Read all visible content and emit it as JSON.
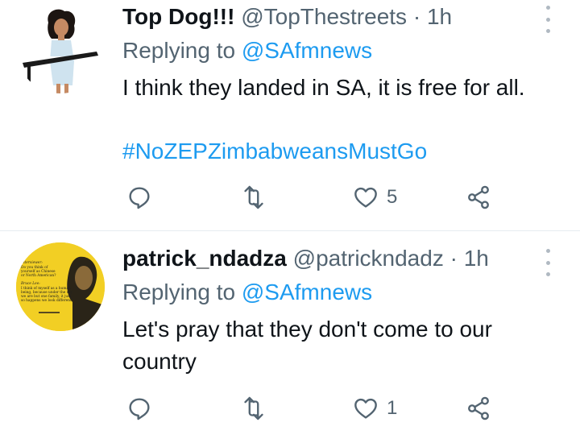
{
  "tweets": [
    {
      "display_name": "Top Dog!!!",
      "handle": "@TopThestreets",
      "dot": "·",
      "time": "1h",
      "replying_prefix": "Replying to",
      "replying_to": "@SAfmnews",
      "text": "I think they landed in SA, it is free for all.",
      "hashtag": "#NoZEPZimbabweansMustGo",
      "like_count": "5",
      "icons": [
        "reply-icon",
        "retweet-icon",
        "like-icon",
        "share-icon",
        "more-icon"
      ]
    },
    {
      "display_name": "patrick_ndadza",
      "handle": "@patrickndadz",
      "dot": "·",
      "time": "1h",
      "replying_prefix": "Replying to",
      "replying_to": "@SAfmnews",
      "text_line1": "Let's pray that they don't come to our",
      "text_line2": "country",
      "like_count": "1",
      "avatar_text": {
        "l1": "Interviewer:",
        "l2": "Do you think of",
        "l3": "yourself as Chinese",
        "l4": "or North American?",
        "l5": "Bruce Lee:",
        "l6": "I think of myself as a human",
        "l7": "being, because under the sky",
        "l8": "we are but one family, it just",
        "l9": "so happens we look different."
      },
      "icons": [
        "reply-icon",
        "retweet-icon",
        "like-icon",
        "share-icon",
        "more-icon"
      ]
    }
  ],
  "colors": {
    "text": "#0f1419",
    "secondary": "#536471",
    "link": "#1d9bf0",
    "divider": "#e6ecf0",
    "avatar2_bg": "#f2cf24"
  }
}
